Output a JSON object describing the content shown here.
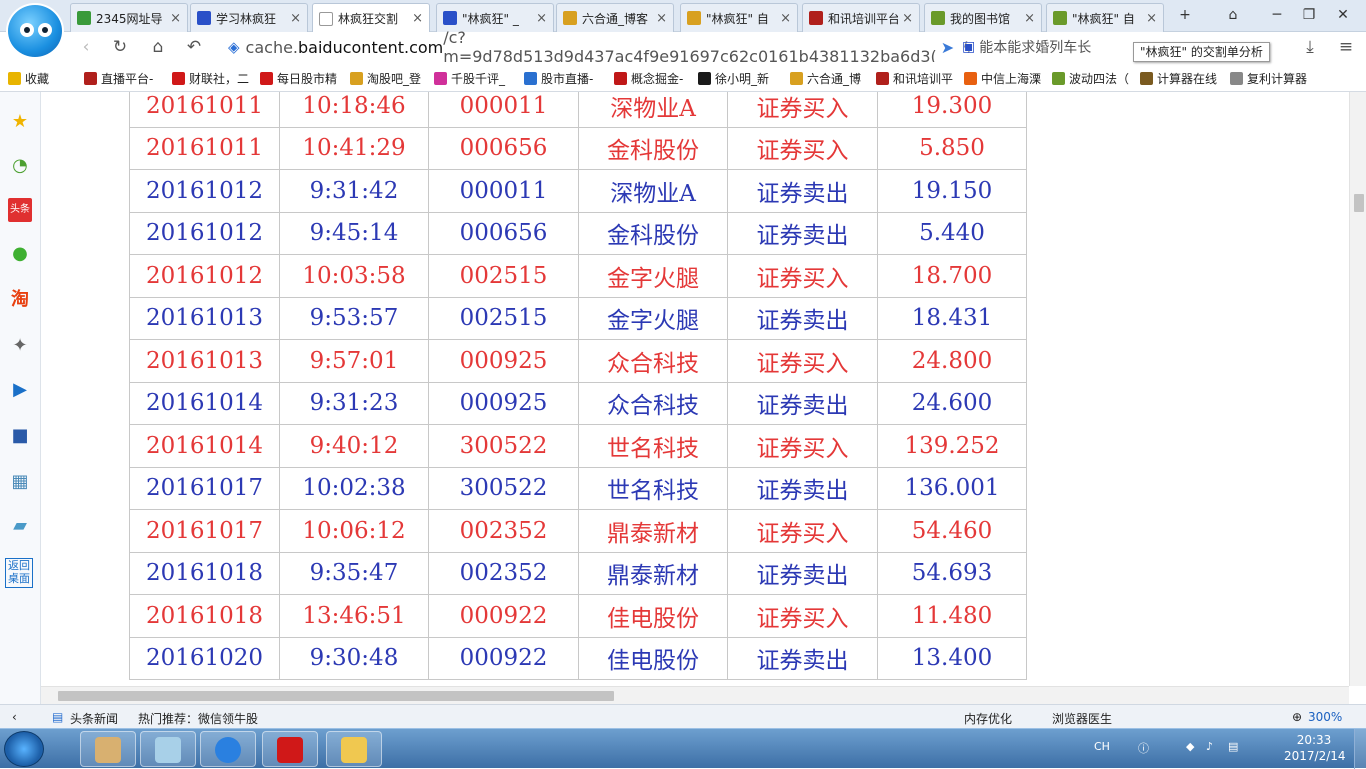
{
  "tabs": [
    {
      "label": "2345网址导",
      "color": "#3a9a3a"
    },
    {
      "label": "学习林疯狂",
      "color": "#2a50c8"
    },
    {
      "label": "林疯狂交割",
      "color": "#ffffff",
      "active": true
    },
    {
      "label": "\"林疯狂\" _",
      "color": "#2a50c8"
    },
    {
      "label": "六合通_博客",
      "color": "#d8a020"
    },
    {
      "label": "\"林疯狂\" 自",
      "color": "#d8a020"
    },
    {
      "label": "和讯培训平台",
      "color": "#b0201c"
    },
    {
      "label": "我的图书馆",
      "color": "#6a9a2a"
    },
    {
      "label": "\"林疯狂\" 自",
      "color": "#6a9a2a"
    }
  ],
  "tab_new": "+",
  "tab_close": "×",
  "window": {
    "minimize": "─",
    "restore": "❐",
    "close": "✕",
    "skin": "⌂"
  },
  "address": {
    "prefix": "cache.",
    "domain": "baiducontent.com",
    "path": "/c?m=9d78d513d9d437ac4f9e91697c62c0161b4381132ba6d3(",
    "search_text": "能本能求婚列车长"
  },
  "tooltip": "\"林疯狂\" 的交割单分析",
  "bookmarks": [
    {
      "label": "收藏",
      "color": "#e8b400"
    },
    {
      "label": "直播平台-",
      "color": "#b0201c"
    },
    {
      "label": "财联社，二",
      "color": "#d01818"
    },
    {
      "label": "每日股市精",
      "color": "#d01818"
    },
    {
      "label": "淘股吧_登",
      "color": "#d8a020"
    },
    {
      "label": "千股千评_",
      "color": "#d0309a"
    },
    {
      "label": "股市直播-",
      "color": "#2a70d0"
    },
    {
      "label": "概念掘金-",
      "color": "#c01818"
    },
    {
      "label": "徐小明_新",
      "color": "#1a1a1a"
    },
    {
      "label": "六合通_博",
      "color": "#d8a020"
    },
    {
      "label": "和讯培训平",
      "color": "#b0201c"
    },
    {
      "label": "中信上海溧",
      "color": "#e86010"
    },
    {
      "label": "波动四法（",
      "color": "#6a9a2a"
    },
    {
      "label": "计算器在线",
      "color": "#7a5a20"
    },
    {
      "label": "复利计算器",
      "color": "#888888"
    }
  ],
  "sidebar": {
    "items": [
      "favorites-icon",
      "history-icon",
      "news-icon",
      "chat-icon",
      "taobao-icon",
      "game-icon",
      "video-icon",
      "computer-icon",
      "calculator-icon",
      "notebook-icon"
    ],
    "back_to_desktop": "返回桌面",
    "taobao_label": "淘",
    "news_label": "头条"
  },
  "trades": [
    {
      "date": "20161011",
      "time": "10:18:46",
      "code": "000011",
      "name": "深物业A",
      "action": "证券买入",
      "price": "19.300",
      "type": "buy"
    },
    {
      "date": "20161011",
      "time": "10:41:29",
      "code": "000656",
      "name": "金科股份",
      "action": "证券买入",
      "price": "5.850",
      "type": "buy"
    },
    {
      "date": "20161012",
      "time": "9:31:42",
      "code": "000011",
      "name": "深物业A",
      "action": "证券卖出",
      "price": "19.150",
      "type": "sell"
    },
    {
      "date": "20161012",
      "time": "9:45:14",
      "code": "000656",
      "name": "金科股份",
      "action": "证券卖出",
      "price": "5.440",
      "type": "sell"
    },
    {
      "date": "20161012",
      "time": "10:03:58",
      "code": "002515",
      "name": "金字火腿",
      "action": "证券买入",
      "price": "18.700",
      "type": "buy"
    },
    {
      "date": "20161013",
      "time": "9:53:57",
      "code": "002515",
      "name": "金字火腿",
      "action": "证券卖出",
      "price": "18.431",
      "type": "sell"
    },
    {
      "date": "20161013",
      "time": "9:57:01",
      "code": "000925",
      "name": "众合科技",
      "action": "证券买入",
      "price": "24.800",
      "type": "buy"
    },
    {
      "date": "20161014",
      "time": "9:31:23",
      "code": "000925",
      "name": "众合科技",
      "action": "证券卖出",
      "price": "24.600",
      "type": "sell"
    },
    {
      "date": "20161014",
      "time": "9:40:12",
      "code": "300522",
      "name": "世名科技",
      "action": "证券买入",
      "price": "139.252",
      "type": "buy"
    },
    {
      "date": "20161017",
      "time": "10:02:38",
      "code": "300522",
      "name": "世名科技",
      "action": "证券卖出",
      "price": "136.001",
      "type": "sell"
    },
    {
      "date": "20161017",
      "time": "10:06:12",
      "code": "002352",
      "name": "鼎泰新材",
      "action": "证券买入",
      "price": "54.460",
      "type": "buy"
    },
    {
      "date": "20161018",
      "time": "9:35:47",
      "code": "002352",
      "name": "鼎泰新材",
      "action": "证券卖出",
      "price": "54.693",
      "type": "sell"
    },
    {
      "date": "20161018",
      "time": "13:46:51",
      "code": "000922",
      "name": "佳电股份",
      "action": "证券买入",
      "price": "11.480",
      "type": "buy"
    },
    {
      "date": "20161020",
      "time": "9:30:48",
      "code": "000922",
      "name": "佳电股份",
      "action": "证券卖出",
      "price": "13.400",
      "type": "sell"
    }
  ],
  "colors": {
    "buy": "#e43838",
    "sell": "#2c39b4"
  },
  "status": {
    "news": "头条新闻",
    "hot": "热门推荐：微信领牛股",
    "memory": "内存优化",
    "doctor": "浏览器医生",
    "zoom": "300%"
  },
  "taskbar": {
    "lang": "CH",
    "time": "20:33",
    "date": "2017/2/14"
  }
}
